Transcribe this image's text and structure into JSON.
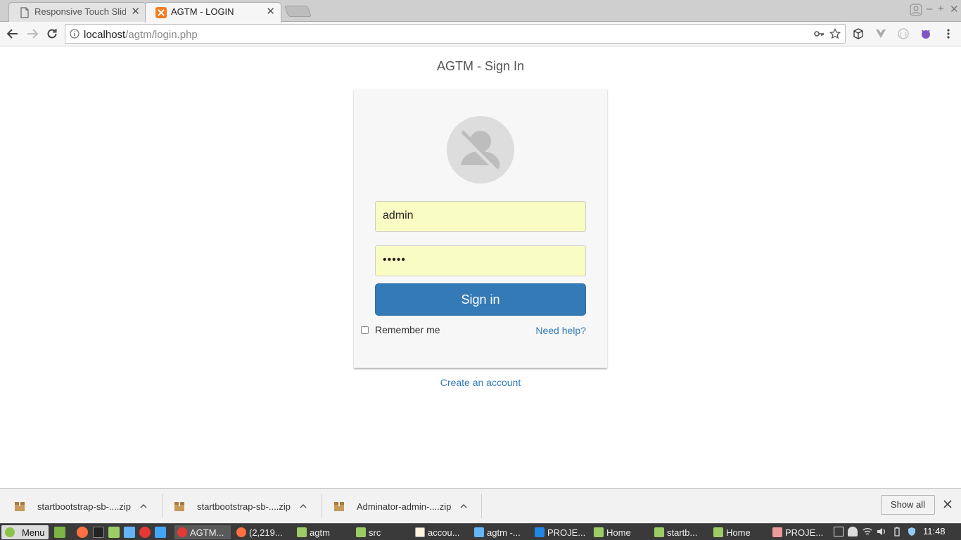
{
  "browser": {
    "tabs": [
      {
        "title": "Responsive Touch Slider",
        "active": false
      },
      {
        "title": "AGTM - LOGIN",
        "active": true
      }
    ],
    "url_host": "localhost",
    "url_path": "/agtm/login.php"
  },
  "page": {
    "title": "AGTM - Sign In",
    "username_value": "admin",
    "password_value": "•••••",
    "signin_label": "Sign in",
    "remember_label": "Remember me",
    "help_label": "Need help?",
    "create_label": "Create an account"
  },
  "downloads": {
    "items": [
      {
        "name": "startbootstrap-sb-....zip"
      },
      {
        "name": "startbootstrap-sb-....zip"
      },
      {
        "name": "Adminator-admin-....zip"
      }
    ],
    "show_all_label": "Show all"
  },
  "taskbar": {
    "menu_label": "Menu",
    "windows": [
      {
        "label": "AGTM..."
      },
      {
        "label": "(2,219..."
      },
      {
        "label": "agtm"
      },
      {
        "label": "src"
      },
      {
        "label": "accou..."
      },
      {
        "label": "agtm -..."
      },
      {
        "label": "PROJE..."
      },
      {
        "label": "Home"
      },
      {
        "label": "startb..."
      },
      {
        "label": "Home"
      },
      {
        "label": "PROJE..."
      }
    ],
    "clock": "11:48"
  },
  "colors": {
    "primary_button": "#337ab7",
    "link": "#337ab7",
    "autofill_bg": "#fafdc3"
  }
}
